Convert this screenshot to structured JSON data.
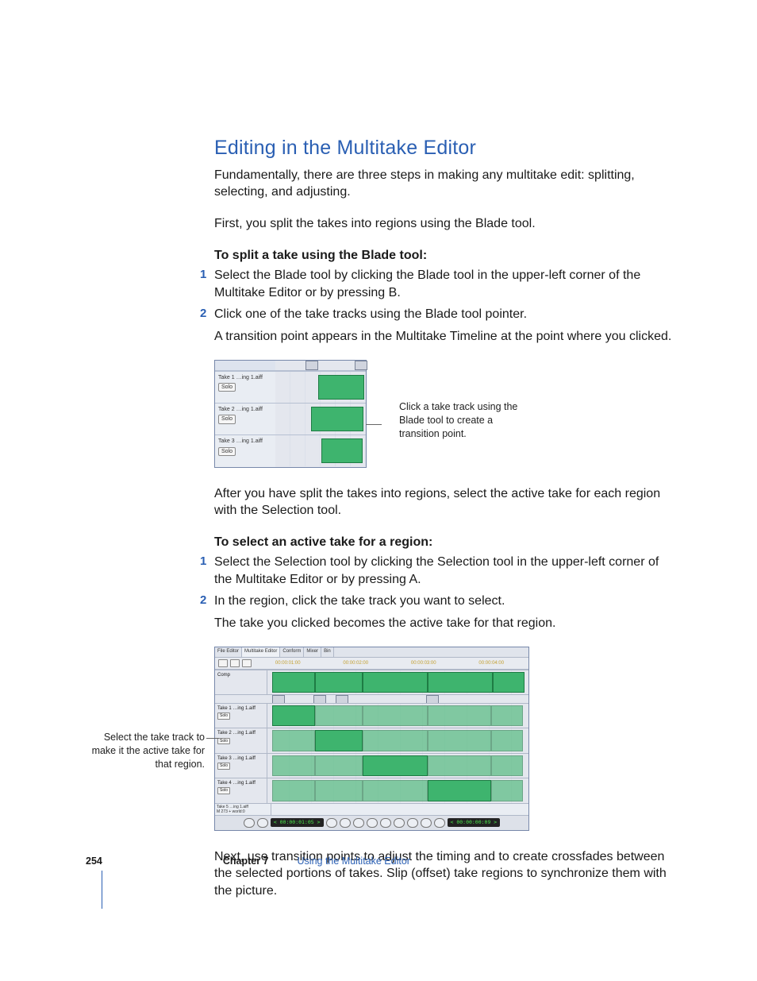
{
  "title": "Editing in the Multitake Editor",
  "intro1": "Fundamentally, there are three steps in making any multitake edit: splitting, selecting, and adjusting.",
  "intro2": "First, you split the takes into regions using the Blade tool.",
  "heading_split": "To split a take using the Blade tool:",
  "steps_split": {
    "n1": "1",
    "t1": "Select the Blade tool by clicking the Blade tool in the upper-left corner of the Multitake Editor or by pressing B.",
    "n2": "2",
    "t2": "Click one of the take tracks using the Blade tool pointer.",
    "follow": "A transition point appears in the Multitake Timeline at the point where you clicked."
  },
  "fig1": {
    "tracks": {
      "t1": "Take 1  …ing 1.aiff",
      "t2": "Take 2  …ing 1.aiff",
      "t3": "Take 3  …ing 1.aiff",
      "solo": "Solo"
    },
    "callout": "Click a take track using the Blade tool to create a transition point."
  },
  "after_split": "After you have split the takes into regions, select the active take for each region with the Selection tool.",
  "heading_select": "To select an active take for a region:",
  "steps_select": {
    "n1": "1",
    "t1": "Select the Selection tool by clicking the Selection tool in the upper-left corner of the Multitake Editor or by pressing A.",
    "n2": "2",
    "t2": "In the region, click the take track you want to select.",
    "follow": "The take you clicked becomes the active take for that region."
  },
  "fig2": {
    "tabs": {
      "file": "File Editor",
      "multi": "Multitake Editor",
      "conform": "Conform",
      "mixer": "Mixer",
      "bin": "Bin"
    },
    "timecodes": {
      "a": "00:00:01:00",
      "b": "00:00:02:00",
      "c": "00:00:03:00",
      "d": "00:00:04:00"
    },
    "tracks": {
      "comp": "Comp",
      "t1": "Take 1  …ing 1.aiff",
      "t2": "Take 2  …ing 1.aiff",
      "t3": "Take 3  …ing 1.aiff",
      "t4": "Take 4  …ing 1.aiff",
      "t5": "Take 5  …ing 1.aiff",
      "t5b": "M  273 +  world:0",
      "solo": "Solo"
    },
    "counters": {
      "left": "< 00:00:01:05 >",
      "right": "< 00:00:00:09 >"
    },
    "callout": "Select the take track to make it the active take for that region."
  },
  "closing": "Next, use transition points to adjust the timing and to create crossfades between the selected portions of takes. Slip (offset) take regions to synchronize them with the picture.",
  "footer": {
    "page": "254",
    "chapter_label": "Chapter 7",
    "chapter_title": "Using the Multitake Editor"
  }
}
